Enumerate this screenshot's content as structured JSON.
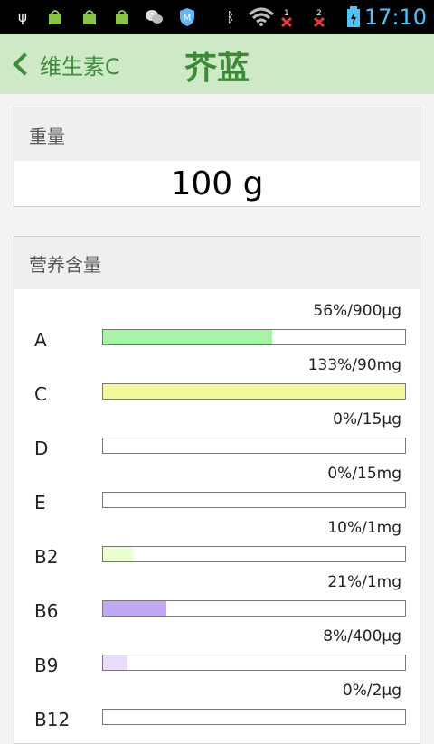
{
  "status": {
    "time": "17:10",
    "notif_count_1": "1",
    "notif_count_2": "2"
  },
  "nav": {
    "back_label": "维生素C",
    "title": "芥蓝"
  },
  "weight": {
    "header": "重量",
    "value": "100 g"
  },
  "nutrients": {
    "header": "营养含量",
    "items": [
      {
        "name": "A",
        "pct": "56%/900μg",
        "ratio": 0.56,
        "color": "#a6f5a6"
      },
      {
        "name": "C",
        "pct": "133%/90mg",
        "ratio": 1.0,
        "color": "#f3f99b"
      },
      {
        "name": "D",
        "pct": "0%/15μg",
        "ratio": 0.0,
        "color": "#cccccc"
      },
      {
        "name": "E",
        "pct": "0%/15mg",
        "ratio": 0.0,
        "color": "#cccccc"
      },
      {
        "name": "B2",
        "pct": "10%/1mg",
        "ratio": 0.1,
        "color": "#eaffd0"
      },
      {
        "name": "B6",
        "pct": "21%/1mg",
        "ratio": 0.21,
        "color": "#c0a8f4"
      },
      {
        "name": "B9",
        "pct": "8%/400μg",
        "ratio": 0.08,
        "color": "#ecdcfb"
      },
      {
        "name": "B12",
        "pct": "0%/2μg",
        "ratio": 0.0,
        "color": "#cccccc"
      }
    ]
  }
}
